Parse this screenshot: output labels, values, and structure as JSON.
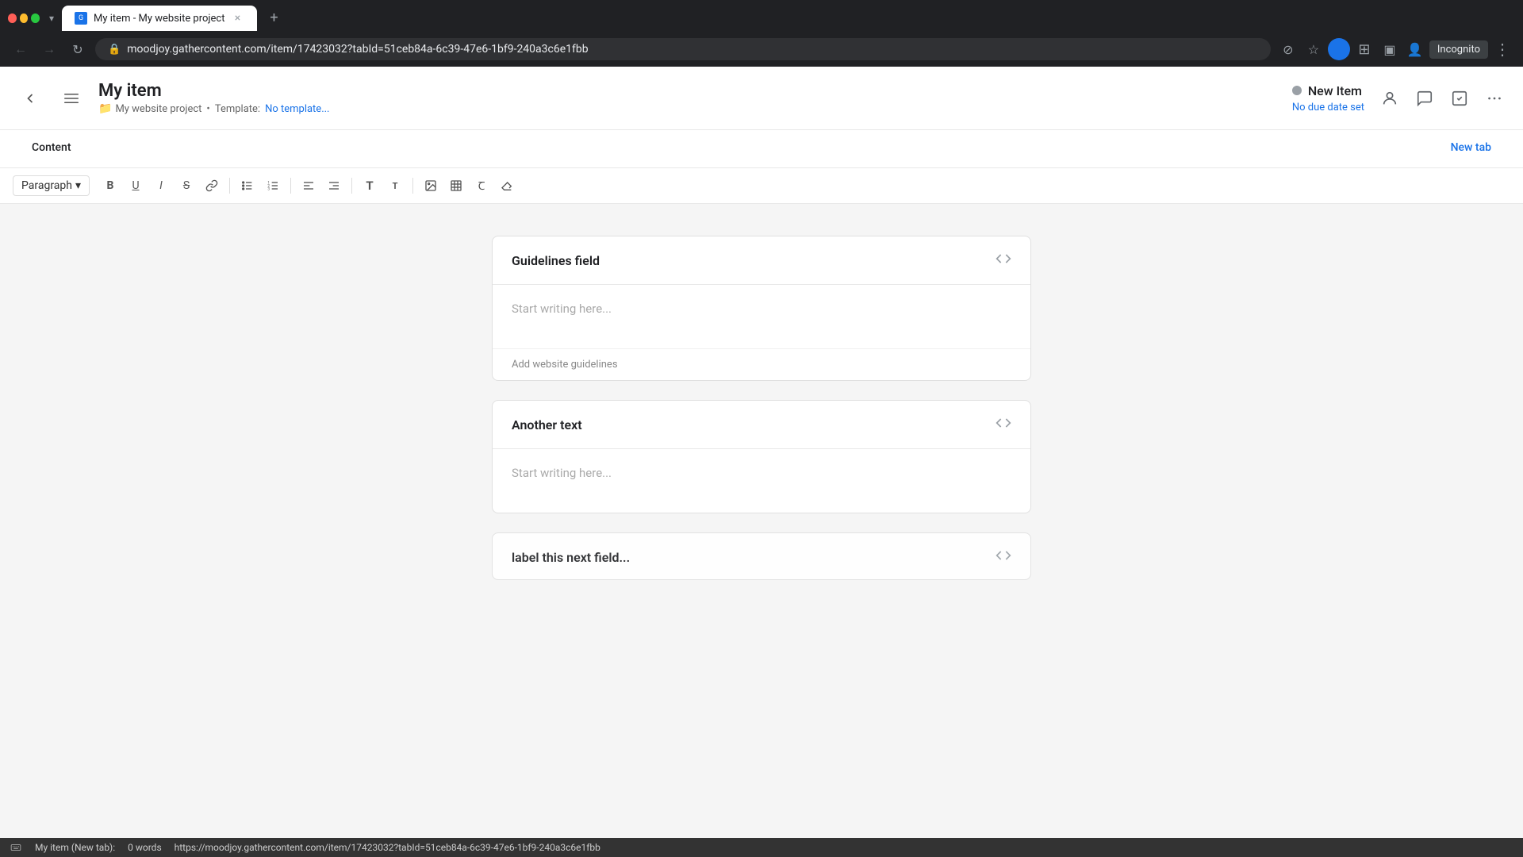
{
  "browser": {
    "tab": {
      "favicon": "G",
      "title": "My item - My website project",
      "close_label": "×"
    },
    "new_tab_label": "+",
    "nav": {
      "back_label": "←",
      "forward_label": "→",
      "refresh_label": "↻",
      "address": "moodjoy.gathercontent.com/item/17423032?tabId=51ceb84a-6c39-47e6-1bf9-240a3c6e1fbb",
      "incognito_label": "Incognito"
    }
  },
  "app": {
    "item_title": "My item",
    "project_name": "My website project",
    "template_label": "Template:",
    "template_value": "No template...",
    "status": {
      "dot_color": "#9aa0a6",
      "label": "New Item",
      "due_date": "No due date set"
    },
    "tabs": {
      "content_label": "Content",
      "new_tab_label": "New tab"
    },
    "toolbar": {
      "paragraph_label": "Paragraph",
      "chevron": "▾",
      "bold": "B",
      "underline": "U",
      "italic": "I",
      "strikethrough": "S",
      "link": "🔗",
      "list_ul": "≡",
      "list_ol": "≣",
      "align_left": "⬛",
      "align_right": "⬛",
      "text_T": "T",
      "text_T2": "T",
      "image": "🖼",
      "table": "⊞",
      "text_format": "Ꞇ",
      "eraser": "◎"
    },
    "fields": [
      {
        "id": "guidelines",
        "title": "Guidelines field",
        "placeholder": "Start writing here...",
        "footer": "Add website guidelines",
        "has_footer": true
      },
      {
        "id": "another-text",
        "title": "Another text",
        "placeholder": "Start writing here...",
        "footer": null,
        "has_footer": false
      },
      {
        "id": "label-field",
        "title": "label this next field...",
        "placeholder": "",
        "footer": null,
        "has_footer": false
      }
    ]
  },
  "status_bar": {
    "words": "0 words",
    "tab_ref": "My item (New tab):",
    "url": "https://moodjoy.gathercontent.com/item/17423032?tabId=51ceb84a-6c39-47e6-1bf9-240a3c6e1fbb"
  }
}
